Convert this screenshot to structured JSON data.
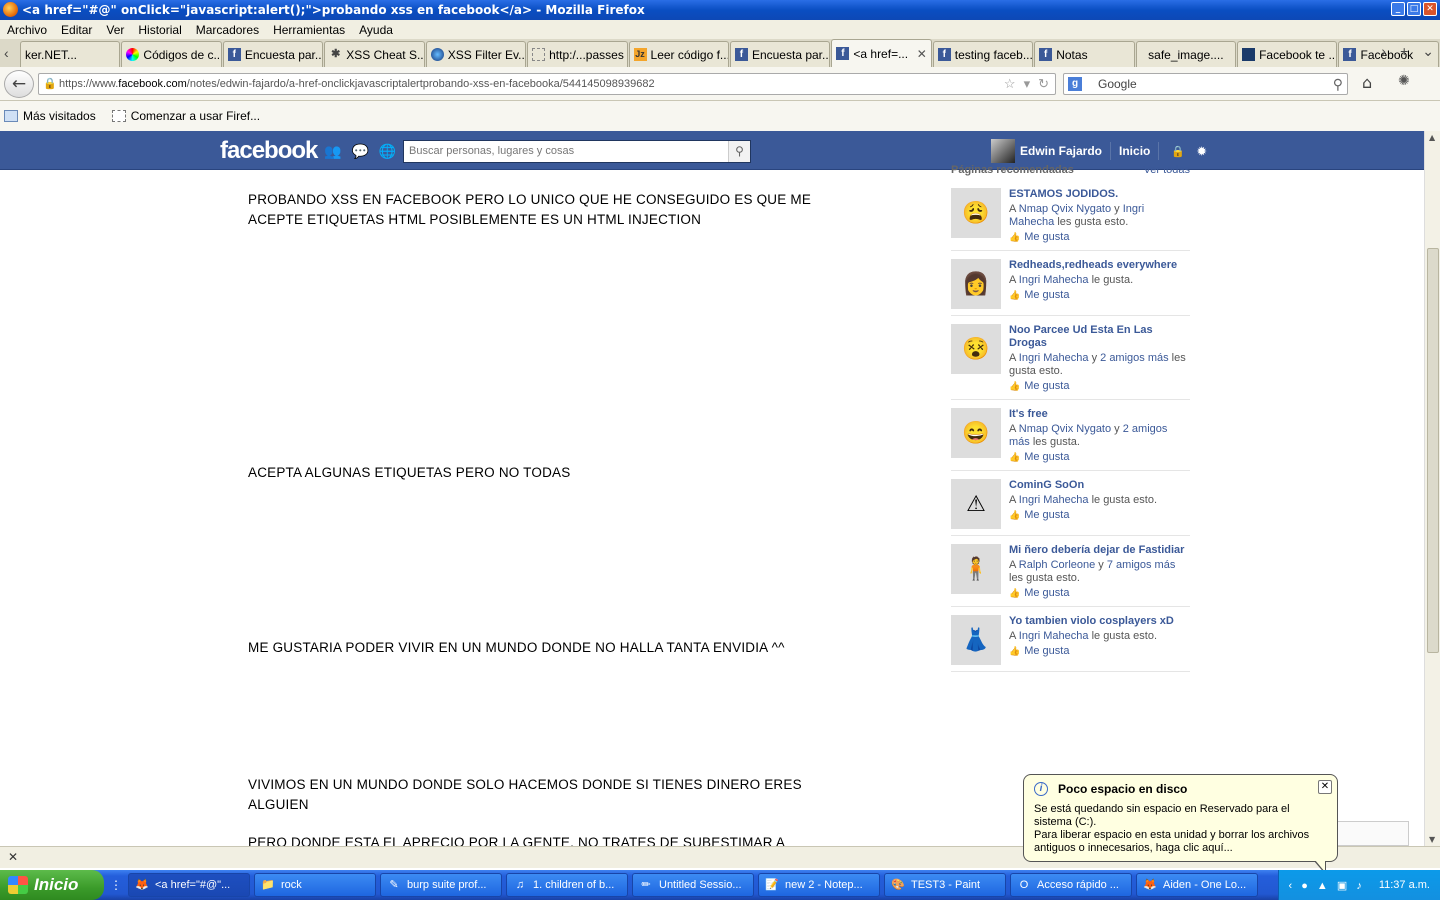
{
  "window": {
    "title": "<a href=\"#@\" onClick=\"javascript:alert();\">probando xss en facebook</a> - Mozilla Firefox"
  },
  "menu": [
    "Archivo",
    "Editar",
    "Ver",
    "Historial",
    "Marcadores",
    "Herramientas",
    "Ayuda"
  ],
  "tabs": [
    {
      "label": "ker.NET...",
      "icon": "none"
    },
    {
      "label": "Códigos de c...",
      "icon": "color-wheel-icon"
    },
    {
      "label": "Encuesta par...",
      "icon": "facebook-icon"
    },
    {
      "label": "XSS Cheat S...",
      "icon": "bug-icon"
    },
    {
      "label": "XSS Filter Ev...",
      "icon": "globe-icon"
    },
    {
      "label": "http:/...passes",
      "icon": "blank-page-icon"
    },
    {
      "label": "Leer código f...",
      "icon": "jz-icon"
    },
    {
      "label": "Encuesta par...",
      "icon": "facebook-icon"
    },
    {
      "label": "<a href=...",
      "icon": "facebook-icon",
      "active": true
    },
    {
      "label": "testing faceb...",
      "icon": "facebook-icon"
    },
    {
      "label": "Notas",
      "icon": "facebook-icon"
    },
    {
      "label": "safe_image....",
      "icon": "none"
    },
    {
      "label": "Facebook te ...",
      "icon": "dark-icon"
    },
    {
      "label": "Facebook",
      "icon": "facebook-icon"
    }
  ],
  "nav": {
    "url_prefix": "https://www.",
    "url_host": "facebook.com",
    "url_path": "/notes/edwin-fajardo/a-href-onclickjavascriptalertprobando-xss-en-facebooka/544145098939682",
    "search_engine": "Google"
  },
  "bookmarks": [
    "Más visitados",
    "Comenzar a usar Firef..."
  ],
  "facebook": {
    "logo": "facebook",
    "search_placeholder": "Buscar personas, lugares y cosas",
    "user_name": "Edwin Fajardo",
    "home_label": "Inicio",
    "brand_color": "#3b5998"
  },
  "note": {
    "p1": "PROBANDO XSS EN FACEBOOK PERO LO UNICO QUE HE CONSEGUIDO ES QUE ME ACEPTE ETIQUETAS HTML POSIBLEMENTE ES UN HTML INJECTION",
    "p2": "ACEPTA ALGUNAS ETIQUETAS PERO NO TODAS",
    "p3": "ME GUSTARIA PODER VIVIR EN UN MUNDO DONDE NO HALLA TANTA ENVIDIA ^^",
    "p4": "VIVIMOS EN UN MUNDO DONDE SOLO HACEMOS DONDE SI TIENES DINERO ERES ALGUIEN",
    "p5": "PERO DONDE ESTA EL APRECIO POR LA GENTE, NO TRATES DE SUBESTIMAR A"
  },
  "sidebar": {
    "heading": "Páginas recomendadas",
    "see_all": "Ver todas",
    "like_label": "Me gusta",
    "pages": [
      {
        "name": "ESTAMOS JODIDOS.",
        "prefix": "A ",
        "link1": "Nmap Qvix Nygato",
        "mid": " y ",
        "link2": "Ingri Mahecha",
        "suffix": " les gusta esto.",
        "thumb": "😩"
      },
      {
        "name": "Redheads,redheads everywhere",
        "prefix": "A ",
        "link1": "Ingri Mahecha",
        "mid": "",
        "link2": "",
        "suffix": " le gusta.",
        "thumb": "👩"
      },
      {
        "name": "Noo Parcee Ud Esta En Las Drogas",
        "prefix": "A ",
        "link1": "Ingri Mahecha",
        "mid": " y ",
        "link2": "2 amigos más",
        "suffix": " les gusta esto.",
        "thumb": "😵"
      },
      {
        "name": "It's free",
        "prefix": "A ",
        "link1": "Nmap Qvix Nygato",
        "mid": " y ",
        "link2": "2 amigos más",
        "suffix": " les gusta.",
        "thumb": "😄"
      },
      {
        "name": "CominG SoOn",
        "prefix": "A ",
        "link1": "Ingri Mahecha",
        "mid": "",
        "link2": "",
        "suffix": " le gusta esto.",
        "thumb": "⚠"
      },
      {
        "name": "Mi ñero debería dejar de Fastidiar",
        "prefix": "A ",
        "link1": "Ralph Corleone",
        "mid": " y ",
        "link2": "7 amigos más",
        "suffix": " les gusta esto.",
        "thumb": "🧍"
      },
      {
        "name": "Yo tambien violo cosplayers xD",
        "prefix": "A ",
        "link1": "Ingri Mahecha",
        "mid": "",
        "link2": "",
        "suffix": " le gusta esto.",
        "thumb": "👗"
      }
    ]
  },
  "balloon": {
    "title": "Poco espacio en disco",
    "body1": "Se está quedando sin espacio en Reservado para el sistema (C:).",
    "body2": "Para liberar espacio en esta unidad y borrar los archivos antiguos o innecesarios, haga clic aquí..."
  },
  "taskbar": {
    "start_label": "Inicio",
    "buttons": [
      {
        "label": "<a href=\"#@\"...",
        "icon": "firefox-icon",
        "active": true
      },
      {
        "label": "rock",
        "icon": "folder-icon"
      },
      {
        "label": "burp suite prof...",
        "icon": "burp-icon"
      },
      {
        "label": "1. children of b...",
        "icon": "music-icon"
      },
      {
        "label": "Untitled Sessio...",
        "icon": "pen-icon"
      },
      {
        "label": "new 2 - Notep...",
        "icon": "notepad-icon"
      },
      {
        "label": "TEST3 - Paint",
        "icon": "paint-icon"
      },
      {
        "label": "Acceso rápido ...",
        "icon": "opera-icon"
      },
      {
        "label": "Aiden - One Lo...",
        "icon": "firefox-icon"
      }
    ],
    "clock": "11:37 a.m."
  }
}
